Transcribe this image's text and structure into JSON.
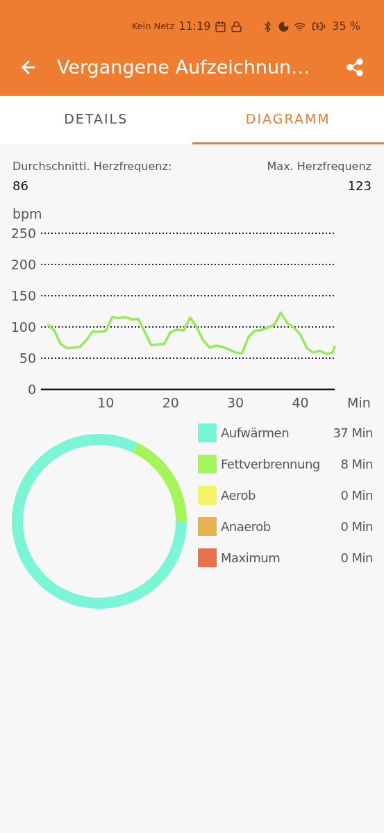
{
  "status_bar": {
    "carrier": "Kein Netz",
    "time": "11:19",
    "battery": "35 %"
  },
  "app_bar": {
    "title": "Vergangene Aufzeichnun…"
  },
  "tabs": [
    {
      "label": "DETAILS",
      "selected": false
    },
    {
      "label": "DIAGRAMM",
      "selected": true
    }
  ],
  "stats": [
    {
      "label": "Durchschnittl. Herzfrequenz:",
      "value": "86"
    },
    {
      "label": "Max. Herzfrequenz",
      "value": "123"
    }
  ],
  "heart_rate_chart": {
    "chart_data": {
      "type": "line",
      "ylabel": "bpm",
      "xlabel": "Min",
      "xlim": [
        0,
        45.3
      ],
      "ylim": [
        0,
        250
      ],
      "xticks": [
        10,
        20,
        30,
        40
      ],
      "yticks": [
        0,
        50,
        100,
        150,
        200,
        250
      ],
      "x": [
        1,
        2,
        3,
        4,
        5,
        6,
        7,
        8,
        9,
        10,
        11,
        12,
        13,
        14,
        15,
        16,
        17,
        18,
        19,
        20,
        21,
        22,
        23,
        24,
        25,
        26,
        27,
        28,
        29,
        30,
        31,
        32,
        33,
        34,
        35,
        36,
        37,
        38,
        39,
        40,
        41,
        42,
        43,
        44,
        45,
        45.3
      ],
      "grid": true,
      "series": [
        {
          "color": "#9be85a",
          "values": [
            104,
            95,
            73,
            66,
            67,
            68,
            79,
            93,
            92,
            94,
            116,
            114,
            116,
            112,
            113,
            92,
            71,
            72,
            73,
            92,
            96,
            94,
            115,
            100,
            79,
            67,
            70,
            68,
            64,
            59,
            58,
            84,
            94,
            95,
            99,
            104,
            123,
            106,
            99,
            88,
            66,
            59,
            62,
            57,
            59,
            70
          ]
        }
      ]
    }
  },
  "zone_chart": {
    "chart_data": {
      "type": "donut",
      "categories": [
        "Aufwärmen",
        "Fettverbrennung",
        "Aerob",
        "Anaerob",
        "Maximum"
      ],
      "values": [
        82.2,
        17.8,
        0,
        0,
        0
      ]
    }
  },
  "zones": [
    {
      "duration": "37 Min",
      "color": "#7af5d6"
    },
    {
      "duration": "8 Min",
      "color": "#a4f55a"
    },
    {
      "duration": "0 Min",
      "color": "#f2f562"
    },
    {
      "duration": "0 Min",
      "color": "#e8b24f"
    },
    {
      "duration": "0 Min",
      "color": "#e8734a"
    }
  ]
}
